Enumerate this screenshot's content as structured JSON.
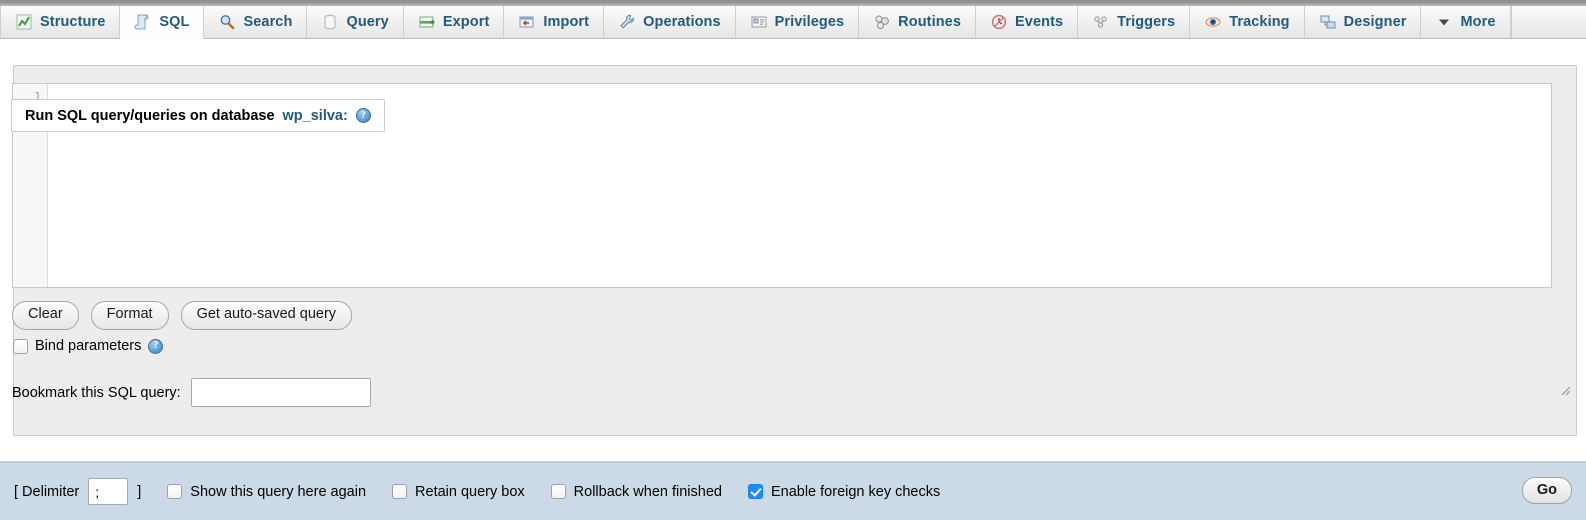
{
  "tabs": [
    {
      "label": "Structure",
      "icon": "structure-icon",
      "active": false
    },
    {
      "label": "SQL",
      "icon": "sql-icon",
      "active": true
    },
    {
      "label": "Search",
      "icon": "search-icon",
      "active": false
    },
    {
      "label": "Query",
      "icon": "query-icon",
      "active": false
    },
    {
      "label": "Export",
      "icon": "export-icon",
      "active": false
    },
    {
      "label": "Import",
      "icon": "import-icon",
      "active": false
    },
    {
      "label": "Operations",
      "icon": "operations-icon",
      "active": false
    },
    {
      "label": "Privileges",
      "icon": "privileges-icon",
      "active": false
    },
    {
      "label": "Routines",
      "icon": "routines-icon",
      "active": false
    },
    {
      "label": "Events",
      "icon": "events-icon",
      "active": false
    },
    {
      "label": "Triggers",
      "icon": "triggers-icon",
      "active": false
    },
    {
      "label": "Tracking",
      "icon": "tracking-icon",
      "active": false
    },
    {
      "label": "Designer",
      "icon": "designer-icon",
      "active": false
    },
    {
      "label": "More",
      "icon": "chevron-down-icon",
      "active": false
    }
  ],
  "query_panel": {
    "legend_prefix": "Run SQL query/queries on database",
    "database_name": "wp_silva:",
    "help_glyph": "?",
    "editor": {
      "line_number": "1",
      "value": ""
    },
    "buttons": {
      "clear": "Clear",
      "format": "Format",
      "autosaved": "Get auto-saved query"
    },
    "bind_parameters": {
      "label": "Bind parameters",
      "checked": false,
      "help_glyph": "?"
    },
    "bookmark": {
      "label": "Bookmark this SQL query:",
      "value": "",
      "placeholder": ""
    }
  },
  "footer": {
    "delimiter_open": "[ Delimiter",
    "delimiter_value": ";",
    "delimiter_close": "]",
    "options": [
      {
        "label": "Show this query here again",
        "checked": false
      },
      {
        "label": "Retain query box",
        "checked": false
      },
      {
        "label": "Rollback when finished",
        "checked": false
      },
      {
        "label": "Enable foreign key checks",
        "checked": true
      }
    ],
    "go_label": "Go"
  },
  "colors": {
    "tab_text": "#235a81",
    "footer_bg": "#ccd9e6",
    "fieldset_bg": "#ededed",
    "checkbox_accent": "#1a8cff"
  }
}
